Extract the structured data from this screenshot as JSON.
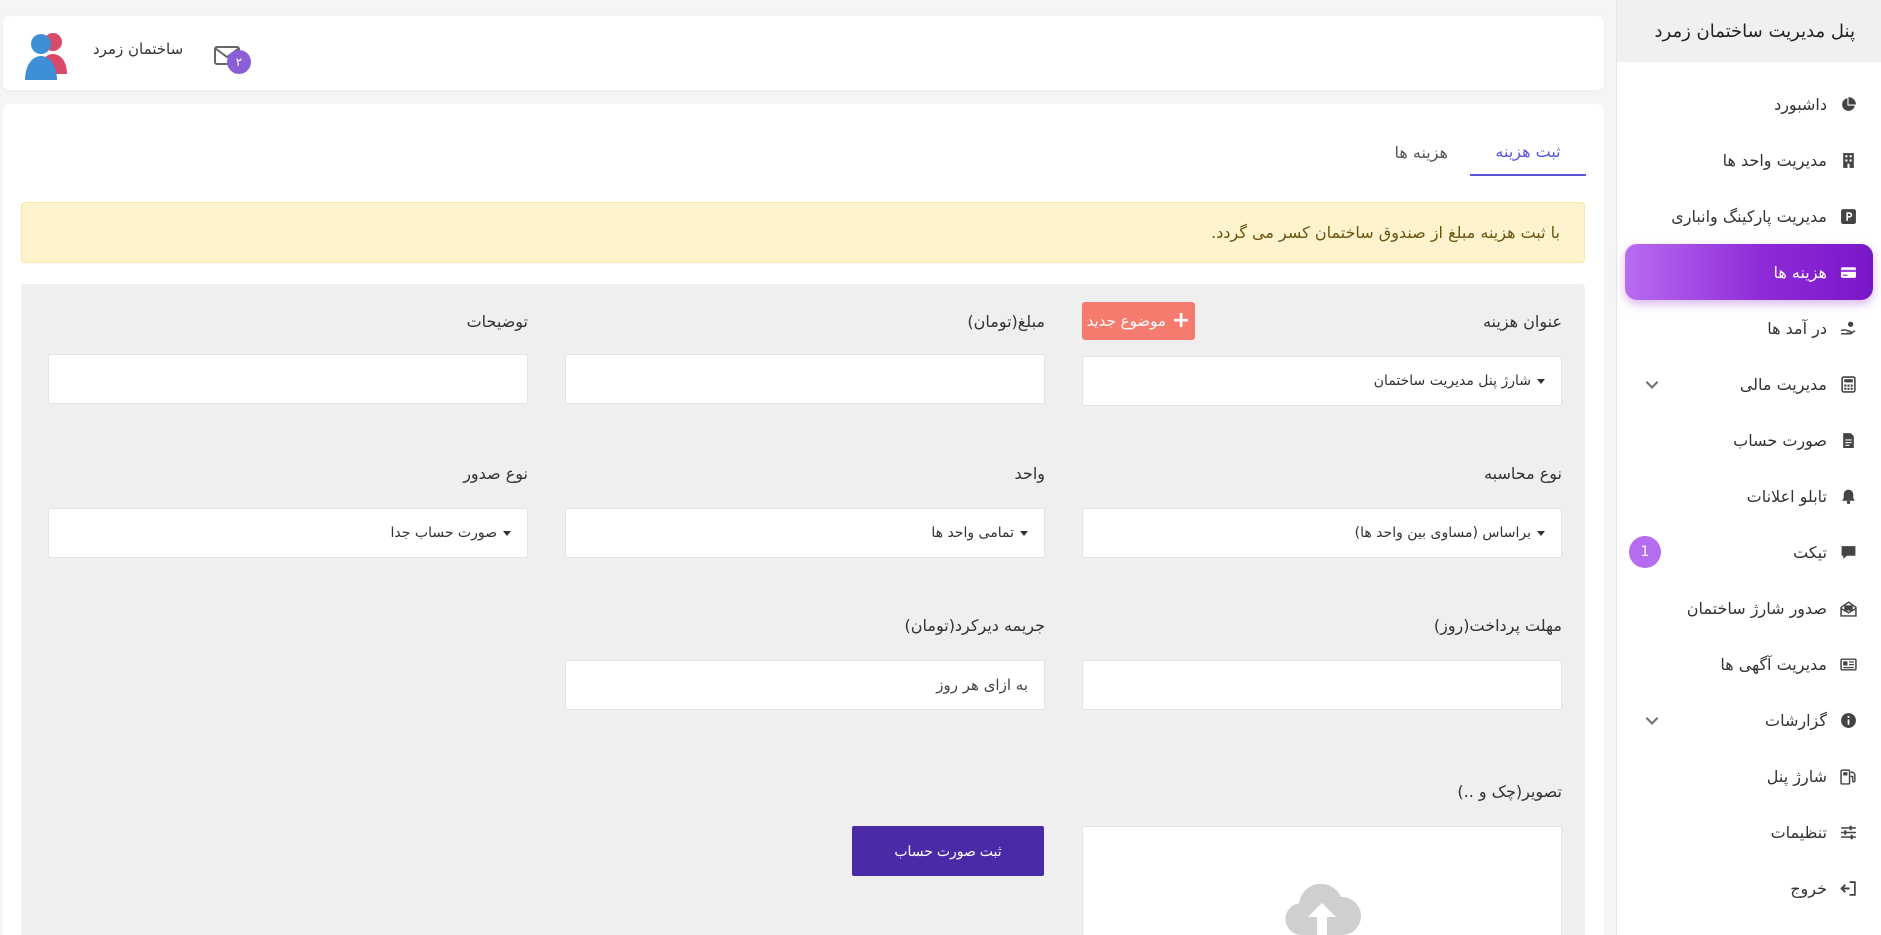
{
  "sidebar": {
    "title": "پنل مدیریت ساختمان زمرد",
    "items": [
      {
        "label": "داشبورد",
        "icon": "pie-chart-icon"
      },
      {
        "label": "مدیریت واحد ها",
        "icon": "building-icon"
      },
      {
        "label": "مدیریت پارکینگ وانباری",
        "icon": "parking-icon"
      },
      {
        "label": "هزینه ها",
        "icon": "credit-card-icon",
        "active": true
      },
      {
        "label": "در آمد ها",
        "icon": "hand-coin-icon"
      },
      {
        "label": "مدیریت مالی",
        "icon": "calculator-icon",
        "expandable": true
      },
      {
        "label": "صورت حساب",
        "icon": "file-icon"
      },
      {
        "label": "تابلو اعلانات",
        "icon": "bell-icon"
      },
      {
        "label": "تیکت",
        "icon": "comment-icon",
        "badge": "1"
      },
      {
        "label": "صدور شارژ ساختمان",
        "icon": "envelope-open-icon"
      },
      {
        "label": "مدیریت آگهی ها",
        "icon": "newspaper-icon"
      },
      {
        "label": "گزارشات",
        "icon": "info-icon",
        "expandable": true
      },
      {
        "label": "شارژ پنل",
        "icon": "charging-icon"
      },
      {
        "label": "تنظیمات",
        "icon": "sliders-icon"
      },
      {
        "label": "خروج",
        "icon": "logout-icon"
      }
    ]
  },
  "header": {
    "building_name": "ساختمان زمرد",
    "mail_count": "۲"
  },
  "tabs": [
    {
      "label": "ثبت هزینه",
      "active": true
    },
    {
      "label": "هزینه ها",
      "active": false
    }
  ],
  "alert": {
    "text": "با ثبت هزینه مبلغ از صندوق ساختمان کسر می گردد."
  },
  "form": {
    "expense_title_label": "عنوان هزینه",
    "new_topic_label": "موضوع جدید",
    "expense_title_value": "شارژ پنل مدیریت ساختمان",
    "amount_label": "مبلغ(تومان)",
    "amount_value": "",
    "description_label": "توضیحات",
    "description_value": "",
    "calc_type_label": "نوع محاسبه",
    "calc_type_value": "براساس (مساوی بین واحد ها)",
    "unit_label": "واحد",
    "unit_value": "تمامی واحد ها",
    "issue_type_label": "نوع صدور",
    "issue_type_value": "صورت حساب جدا",
    "deadline_label": "مهلت پرداخت(روز)",
    "deadline_value": "",
    "penalty_label": "جریمه دیرکرد(تومان)",
    "penalty_placeholder": "به ازای هر روز",
    "image_label": "تصویر(چک و ..)",
    "submit_label": "ثبت صورت حساب"
  },
  "colors": {
    "accent": "#8e2bd8",
    "tab_active": "#5a56d8",
    "alert_bg": "#fdf3cd",
    "new_topic": "#f57b6e",
    "submit": "#4b2aa8"
  }
}
